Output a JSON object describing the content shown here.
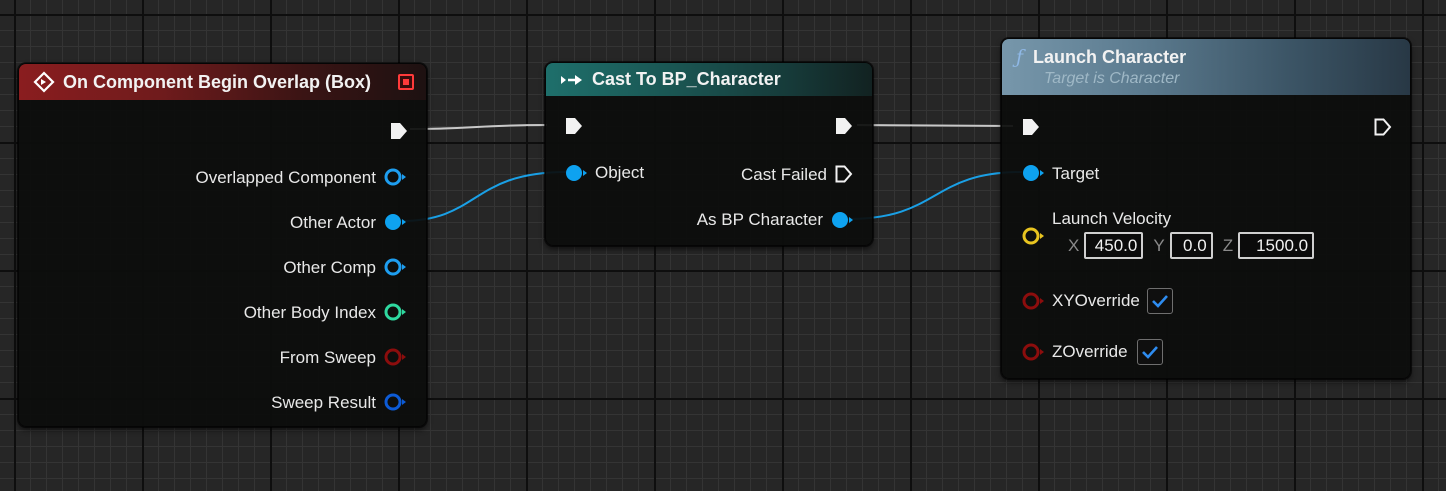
{
  "nodes": {
    "event": {
      "title": "On Component Begin Overlap (Box)",
      "pins": {
        "overlapped_component": "Overlapped Component",
        "other_actor": "Other Actor",
        "other_comp": "Other Comp",
        "other_body_index": "Other Body Index",
        "from_sweep": "From Sweep",
        "sweep_result": "Sweep Result"
      }
    },
    "cast": {
      "title": "Cast To BP_Character",
      "pins": {
        "object": "Object",
        "cast_failed": "Cast Failed",
        "as_bp_character": "As BP Character"
      }
    },
    "launch": {
      "title": "Launch Character",
      "subtitle": "Target is Character",
      "pins": {
        "target": "Target",
        "launch_velocity": "Launch Velocity",
        "xy_override": "XYOverride",
        "z_override": "ZOverride"
      },
      "velocity": {
        "x_label": "X",
        "x": "450.0",
        "y_label": "Y",
        "y": "0.0",
        "z_label": "Z",
        "z": "1500.0"
      },
      "xy_override_checked": true,
      "z_override_checked": true
    }
  },
  "colors": {
    "object_pin": "#0ea2f0",
    "vector_pin": "#e8c420",
    "bool_pin": "#8c0d0d",
    "int_pin": "#2fd9a0",
    "struct_pin": "#0d5bd6",
    "event_header": "#8a1d1f",
    "cast_header": "#1e6f6b",
    "function_header": "#7797ab"
  }
}
